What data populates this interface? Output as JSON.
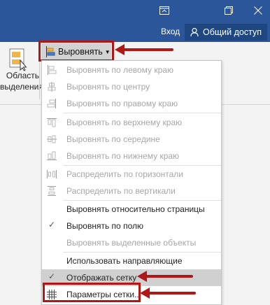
{
  "titlebar": {
    "login_label": "Вход",
    "share_label": "Общий доступ",
    "ribbon_options_icon": "ribbon-display-options-icon",
    "restore_icon": "restore-window-icon",
    "close_icon": "close-icon",
    "color": "#2b579a"
  },
  "ribbon": {
    "selection_pane": {
      "line1": "Область",
      "line2": "выделения"
    },
    "align_button": {
      "label": "Выровнять",
      "icon": "align-left-icon"
    }
  },
  "menu": {
    "items": [
      {
        "label": "Выровнять по левому краю",
        "icon": "align-left-icon",
        "enabled": false
      },
      {
        "label": "Выровнять по центру",
        "icon": "align-center-icon",
        "enabled": false
      },
      {
        "label": "Выровнять по правому краю",
        "icon": "align-right-icon",
        "enabled": false
      },
      {
        "label": "Выровнять по верхнему краю",
        "icon": "align-top-icon",
        "enabled": false
      },
      {
        "label": "Выровнять по середине",
        "icon": "align-middle-icon",
        "enabled": false
      },
      {
        "label": "Выровнять по нижнему краю",
        "icon": "align-bottom-icon",
        "enabled": false
      },
      {
        "label": "Распределить по горизонтали",
        "icon": "distribute-horizontal-icon",
        "enabled": false
      },
      {
        "label": "Распределить по вертикали",
        "icon": "distribute-vertical-icon",
        "enabled": false
      },
      {
        "label": "Выровнять относительно страницы",
        "enabled": true,
        "checked": false
      },
      {
        "label": "Выровнять по полю",
        "enabled": true,
        "checked": true
      },
      {
        "label": "Выровнять выделенные объекты",
        "enabled": false,
        "checked": false
      },
      {
        "label": "Использовать направляющие",
        "enabled": true
      },
      {
        "label": "Отображать сетку",
        "enabled": true,
        "checked": true,
        "highlighted": true
      },
      {
        "label": "Параметры сетки...",
        "icon": "grid-icon",
        "enabled": true
      }
    ]
  },
  "annotations": {
    "color": "#b01717"
  }
}
